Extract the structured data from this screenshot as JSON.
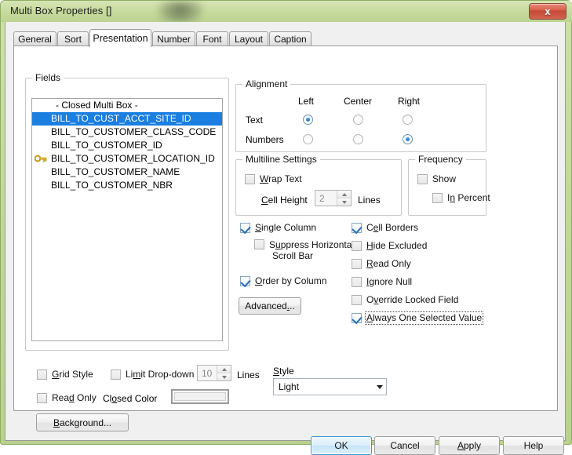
{
  "window": {
    "title": "Multi Box Properties []",
    "close_button": "x",
    "close_icon": "close-icon"
  },
  "tabs": [
    {
      "label": "General",
      "active": false
    },
    {
      "label": "Sort",
      "active": false
    },
    {
      "label": "Presentation",
      "active": true
    },
    {
      "label": "Number",
      "active": false
    },
    {
      "label": "Font",
      "active": false
    },
    {
      "label": "Layout",
      "active": false
    },
    {
      "label": "Caption",
      "active": false
    }
  ],
  "fields": {
    "group_label": "Fields",
    "items": [
      {
        "label": "- Closed Multi Box -",
        "selected": false,
        "key": false
      },
      {
        "label": "BILL_TO_CUST_ACCT_SITE_ID",
        "selected": true,
        "key": false
      },
      {
        "label": "BILL_TO_CUSTOMER_CLASS_CODE",
        "selected": false,
        "key": false
      },
      {
        "label": "BILL_TO_CUSTOMER_ID",
        "selected": false,
        "key": false
      },
      {
        "label": "BILL_TO_CUSTOMER_LOCATION_ID",
        "selected": false,
        "key": true
      },
      {
        "label": "BILL_TO_CUSTOMER_NAME",
        "selected": false,
        "key": false
      },
      {
        "label": "BILL_TO_CUSTOMER_NBR",
        "selected": false,
        "key": false
      }
    ]
  },
  "alignment": {
    "group_label": "Alignment",
    "columns": [
      "Left",
      "Center",
      "Right"
    ],
    "rows": [
      {
        "label": "Text",
        "selected": "Left"
      },
      {
        "label": "Numbers",
        "selected": "Right"
      }
    ]
  },
  "multiline": {
    "group_label": "Multiline Settings",
    "wrap_text_label": "Wrap Text",
    "wrap_text_checked": false,
    "cell_height_label": "Cell Height",
    "cell_height_value": "2",
    "lines_label": "Lines"
  },
  "frequency": {
    "group_label": "Frequency",
    "show_label": "Show",
    "show_checked": false,
    "in_percent_label": "In Percent",
    "in_percent_checked": false
  },
  "options_left": [
    {
      "label": "Single Column",
      "checked": true
    },
    {
      "label": "Suppress Horizontal",
      "label2": "Scroll Bar",
      "checked": false
    },
    {
      "label": "Order by Column",
      "checked": true
    }
  ],
  "options_right": [
    {
      "label": "Cell Borders",
      "checked": true
    },
    {
      "label": "Hide Excluded",
      "checked": false
    },
    {
      "label": "Read Only",
      "checked": false
    },
    {
      "label": "Ignore Null",
      "checked": false
    },
    {
      "label": "Override Locked Field",
      "checked": false
    },
    {
      "label": "Always One Selected Value",
      "checked": true
    }
  ],
  "advanced_button": "Advanced...",
  "bottom": {
    "grid_style_label": "Grid Style",
    "grid_style_checked": false,
    "read_only_label": "Read Only",
    "read_only_checked": false,
    "limit_dropdown_label": "Limit Drop-down to",
    "limit_dropdown_checked": false,
    "limit_dropdown_value": "10",
    "lines_label": "Lines",
    "closed_color_label": "Closed Color",
    "closed_color_value": "#f0f0f0",
    "background_button": "Background...",
    "style_label": "Style",
    "style_value": "Light",
    "style_options": [
      "Light"
    ]
  },
  "footer_buttons": [
    {
      "label": "OK",
      "default": true
    },
    {
      "label": "Cancel",
      "default": false
    },
    {
      "label": "Apply",
      "default": false
    },
    {
      "label": "Help",
      "default": false
    }
  ],
  "colors": {
    "window_border": "#8fae63",
    "titlebar": "#c6da9c",
    "selection": "#1a7fe0",
    "close_button": "#d9604c"
  }
}
